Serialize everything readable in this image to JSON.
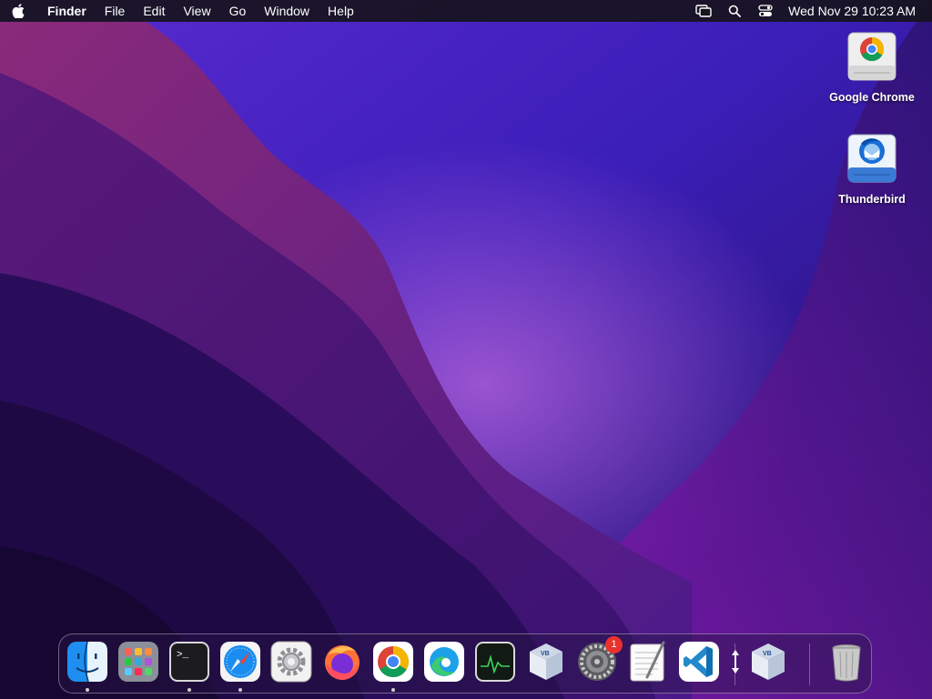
{
  "menubar": {
    "app_name": "Finder",
    "items": [
      "File",
      "Edit",
      "View",
      "Go",
      "Window",
      "Help"
    ],
    "clock": "Wed Nov 29  10:23 AM",
    "status_icons": [
      "screen-mirroring-icon",
      "spotlight-search-icon",
      "control-center-icon"
    ]
  },
  "desktop": {
    "icons": [
      {
        "label": "Google Chrome",
        "icon": "chrome-disk-icon"
      },
      {
        "label": "Thunderbird",
        "icon": "thunderbird-disk-icon"
      }
    ]
  },
  "dock": {
    "items": [
      {
        "name": "finder",
        "running": true
      },
      {
        "name": "launchpad",
        "running": false
      },
      {
        "name": "terminal",
        "running": true
      },
      {
        "name": "safari",
        "running": true
      },
      {
        "name": "system-preferences-gear",
        "running": false
      },
      {
        "name": "firefox",
        "running": false
      },
      {
        "name": "chrome",
        "running": true
      },
      {
        "name": "edge",
        "running": false
      },
      {
        "name": "activity-monitor",
        "running": false
      },
      {
        "name": "virtualbox",
        "running": false
      },
      {
        "name": "system-settings",
        "running": false,
        "badge": "1"
      },
      {
        "name": "textedit",
        "running": false
      },
      {
        "name": "vscode",
        "running": false
      },
      {
        "name": "resize-handle",
        "running": false
      },
      {
        "name": "virtualbox-2",
        "running": false
      },
      {
        "name": "trash",
        "running": false
      }
    ]
  },
  "colors": {
    "menubar_bg": "#16141c",
    "wallpaper_top": "#3a1fc0",
    "wallpaper_mid": "#5a1c9a",
    "wallpaper_dark": "#1a0a3e",
    "badge": "#e8322b"
  }
}
